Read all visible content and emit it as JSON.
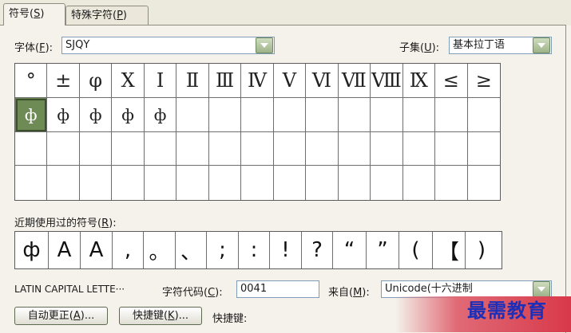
{
  "tabs": {
    "symbols": {
      "label": "符号(",
      "key": "S",
      "close": ")"
    },
    "special": {
      "label": "特殊字符(",
      "key": "P",
      "close": ")"
    }
  },
  "font": {
    "label": "字体(",
    "key": "F",
    "close": "):",
    "value": "SJQY"
  },
  "subset": {
    "label": "子集(",
    "key": "U",
    "close": "):",
    "value": "基本拉丁语"
  },
  "symbol_grid": [
    [
      "°",
      "±",
      "φ",
      "X",
      "I",
      "Ⅱ",
      "Ⅲ",
      "Ⅳ",
      "Ⅴ",
      "Ⅵ",
      "Ⅶ",
      "Ⅷ",
      "Ⅸ",
      "≤",
      "≥"
    ],
    [
      "ф",
      "ф",
      "ф",
      "ф",
      "ф",
      "",
      "",
      "",
      "",
      "",
      "",
      "",
      "",
      "",
      ""
    ],
    [
      "",
      "",
      "",
      "",
      "",
      "",
      "",
      "",
      "",
      "",
      "",
      "",
      "",
      "",
      ""
    ],
    [
      "",
      "",
      "",
      "",
      "",
      "",
      "",
      "",
      "",
      "",
      "",
      "",
      "",
      "",
      ""
    ]
  ],
  "recent": {
    "label": "近期使用过的符号(",
    "key": "R",
    "close": "):",
    "items": [
      "ф",
      "A",
      "A",
      ",",
      "。",
      "、",
      ";",
      ":",
      "!",
      "?",
      "“",
      "”",
      "(",
      "【",
      ")"
    ]
  },
  "char_name": "LATIN CAPITAL LETTE···",
  "char_code": {
    "label": "字符代码(",
    "key": "C",
    "close": "):",
    "value": "0041"
  },
  "from": {
    "label": "来自(",
    "key": "M",
    "close": "):",
    "value": "Unicode(十六进制"
  },
  "buttons": {
    "autocorrect": {
      "label": "自动更正(",
      "key": "A",
      "close": ")..."
    },
    "shortcut": {
      "label": "快捷键(",
      "key": "K",
      "close": ")..."
    }
  },
  "shortcut_label": "快捷键:",
  "watermark": "最需教育",
  "colors": {
    "selected_cell": "#6e8a55",
    "watermark_text": "#1c2fb8"
  }
}
